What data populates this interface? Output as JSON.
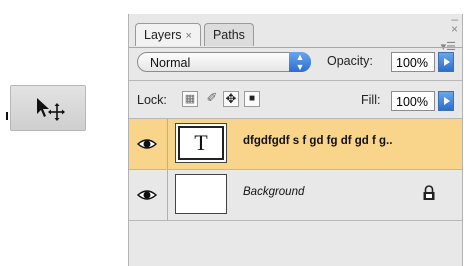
{
  "panel": {
    "tabs": [
      {
        "label": "Layers",
        "close": "×"
      },
      {
        "label": "Paths"
      }
    ],
    "blend_mode": "Normal",
    "opacity_label": "Opacity:",
    "opacity_value": "100%",
    "lock_label": "Lock:",
    "fill_label": "Fill:",
    "fill_value": "100%",
    "layers": [
      {
        "name": "dfgdfgdf s f gd fg df gd f g..",
        "thumbnail": "T",
        "selected": true,
        "visible": true
      },
      {
        "name": "Background",
        "selected": false,
        "visible": true,
        "locked": true
      }
    ]
  },
  "colors": {
    "selected_row": "#f9d58c",
    "accent": "#2a6fd1"
  },
  "icons": [
    "move-tool-icon",
    "eye-icon",
    "lock-transparent-icon",
    "lock-image-icon",
    "lock-position-icon",
    "lock-all-icon",
    "lock-icon",
    "panel-menu-icon",
    "minimize-icon",
    "close-icon"
  ]
}
